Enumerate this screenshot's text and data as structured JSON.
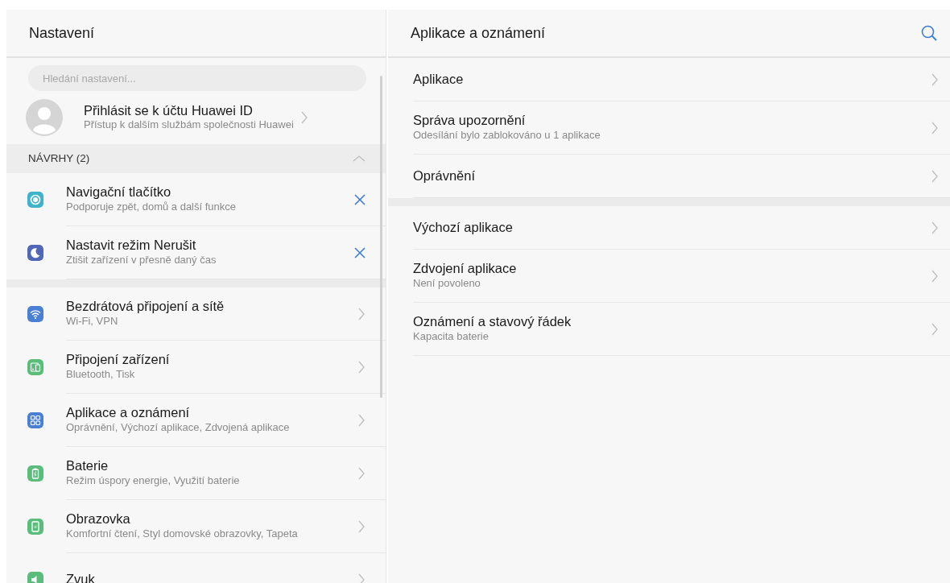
{
  "left": {
    "title": "Nastavení",
    "search": {
      "placeholder": "Hledání nastavení..."
    },
    "account": {
      "title": "Přihlásit se k účtu Huawei ID",
      "subtitle": "Přístup k dalším službám společnosti Huawei"
    },
    "suggestions": {
      "label": "NÁVRHY (2)",
      "expanded": true,
      "items": [
        {
          "kind": "navigation",
          "color": "#3fb3c9",
          "title": "Navigační tlačítko",
          "subtitle": "Podporuje zpět, domů a další funkce"
        },
        {
          "kind": "moon",
          "color": "#5067b8",
          "title": "Nastavit režim Nerušit",
          "subtitle": "Ztišit zařízení v přesně daný čas"
        }
      ]
    },
    "items": [
      {
        "kind": "wifi",
        "color": "#4a80d3",
        "title": "Bezdrátová připojení a sítě",
        "subtitle": "Wi-Fi, VPN"
      },
      {
        "kind": "devices",
        "color": "#5bbd7b",
        "title": "Připojení zařízení",
        "subtitle": "Bluetooth, Tisk"
      },
      {
        "kind": "apps",
        "color": "#4a80d3",
        "title": "Aplikace a oznámení",
        "subtitle": "Oprávnění, Výchozí aplikace, Zdvojená aplikace"
      },
      {
        "kind": "battery",
        "color": "#5bbd7b",
        "title": "Baterie",
        "subtitle": "Režim úspory energie, Využití baterie"
      },
      {
        "kind": "display",
        "color": "#5bbd7b",
        "title": "Obrazovka",
        "subtitle": "Komfortní čtení, Styl domovské obrazovky, Tapeta"
      },
      {
        "kind": "sound",
        "color": "#5bbd7b",
        "title": "Zvuk"
      }
    ]
  },
  "right": {
    "title": "Aplikace a oznámení",
    "groups": [
      [
        {
          "title": "Aplikace"
        },
        {
          "title": "Správa upozornění",
          "subtitle": "Odesílání bylo zablokováno u 1 aplikace"
        },
        {
          "title": "Oprávnění"
        }
      ],
      [
        {
          "title": "Výchozí aplikace"
        },
        {
          "title": "Zdvojení aplikace",
          "subtitle": "Není povoleno"
        },
        {
          "title": "Oznámení a stavový řádek",
          "subtitle": "Kapacita baterie"
        }
      ]
    ]
  }
}
